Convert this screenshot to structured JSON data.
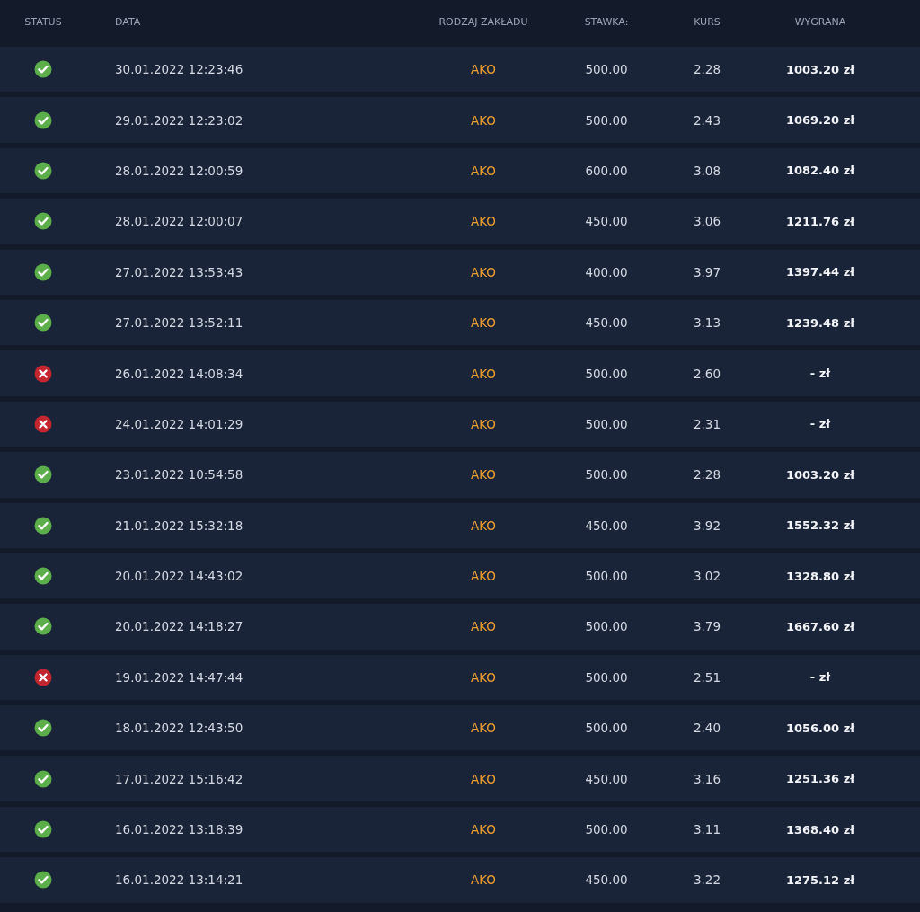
{
  "table": {
    "columns": [
      "STATUS",
      "DATA",
      "RODZAJ ZAKŁADU",
      "STAWKA:",
      "KURS",
      "WYGRANA"
    ],
    "rows": [
      {
        "won": true,
        "date": "30.01.2022 12:23:46",
        "type": "AKO",
        "stake": "500.00",
        "odds": "2.28",
        "win": "1003.20 zł"
      },
      {
        "won": true,
        "date": "29.01.2022 12:23:02",
        "type": "AKO",
        "stake": "500.00",
        "odds": "2.43",
        "win": "1069.20 zł"
      },
      {
        "won": true,
        "date": "28.01.2022 12:00:59",
        "type": "AKO",
        "stake": "600.00",
        "odds": "3.08",
        "win": "1082.40 zł"
      },
      {
        "won": true,
        "date": "28.01.2022 12:00:07",
        "type": "AKO",
        "stake": "450.00",
        "odds": "3.06",
        "win": "1211.76 zł"
      },
      {
        "won": true,
        "date": "27.01.2022 13:53:43",
        "type": "AKO",
        "stake": "400.00",
        "odds": "3.97",
        "win": "1397.44 zł"
      },
      {
        "won": true,
        "date": "27.01.2022 13:52:11",
        "type": "AKO",
        "stake": "450.00",
        "odds": "3.13",
        "win": "1239.48 zł"
      },
      {
        "won": false,
        "date": "26.01.2022 14:08:34",
        "type": "AKO",
        "stake": "500.00",
        "odds": "2.60",
        "win": "- zł"
      },
      {
        "won": false,
        "date": "24.01.2022 14:01:29",
        "type": "AKO",
        "stake": "500.00",
        "odds": "2.31",
        "win": "- zł"
      },
      {
        "won": true,
        "date": "23.01.2022 10:54:58",
        "type": "AKO",
        "stake": "500.00",
        "odds": "2.28",
        "win": "1003.20 zł"
      },
      {
        "won": true,
        "date": "21.01.2022 15:32:18",
        "type": "AKO",
        "stake": "450.00",
        "odds": "3.92",
        "win": "1552.32 zł"
      },
      {
        "won": true,
        "date": "20.01.2022 14:43:02",
        "type": "AKO",
        "stake": "500.00",
        "odds": "3.02",
        "win": "1328.80 zł"
      },
      {
        "won": true,
        "date": "20.01.2022 14:18:27",
        "type": "AKO",
        "stake": "500.00",
        "odds": "3.79",
        "win": "1667.60 zł"
      },
      {
        "won": false,
        "date": "19.01.2022 14:47:44",
        "type": "AKO",
        "stake": "500.00",
        "odds": "2.51",
        "win": "- zł"
      },
      {
        "won": true,
        "date": "18.01.2022 12:43:50",
        "type": "AKO",
        "stake": "500.00",
        "odds": "2.40",
        "win": "1056.00 zł"
      },
      {
        "won": true,
        "date": "17.01.2022 15:16:42",
        "type": "AKO",
        "stake": "450.00",
        "odds": "3.16",
        "win": "1251.36 zł"
      },
      {
        "won": true,
        "date": "16.01.2022 13:18:39",
        "type": "AKO",
        "stake": "500.00",
        "odds": "3.11",
        "win": "1368.40 zł"
      },
      {
        "won": true,
        "date": "16.01.2022 13:14:21",
        "type": "AKO",
        "stake": "450.00",
        "odds": "3.22",
        "win": "1275.12 zł"
      }
    ]
  }
}
